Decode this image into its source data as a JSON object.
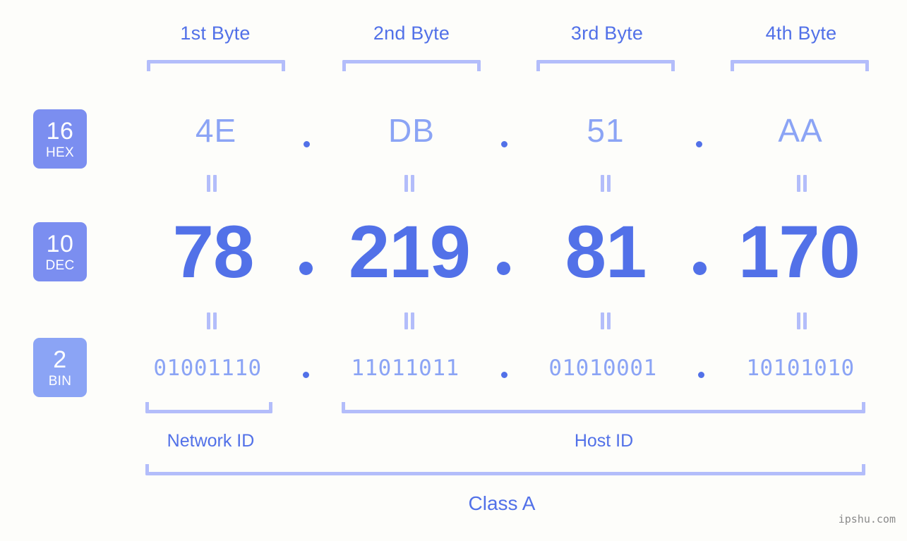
{
  "meta": {
    "watermark": "ipshu.com",
    "accent_strong": "#5271e8",
    "accent_light": "#8ba4f5",
    "accent_pale": "#b3bdfa",
    "badge_bg": "#7b8ef0",
    "badge_bg_light": "#8ba4f5",
    "background": "#fdfdfa"
  },
  "byte_headers": [
    {
      "label": "1st Byte"
    },
    {
      "label": "2nd Byte"
    },
    {
      "label": "3rd Byte"
    },
    {
      "label": "4th Byte"
    }
  ],
  "bases": [
    {
      "number": "16",
      "name": "HEX"
    },
    {
      "number": "10",
      "name": "DEC"
    },
    {
      "number": "2",
      "name": "BIN"
    }
  ],
  "separators": {
    "dot": ".",
    "equals": "="
  },
  "rows": {
    "hex": {
      "base_number": "16",
      "base_name": "HEX",
      "values": [
        "4E",
        "DB",
        "51",
        "AA"
      ]
    },
    "dec": {
      "base_number": "10",
      "base_name": "DEC",
      "values": [
        "78",
        "219",
        "81",
        "170"
      ]
    },
    "bin": {
      "base_number": "2",
      "base_name": "BIN",
      "values": [
        "01001110",
        "11011011",
        "01010001",
        "10101010"
      ]
    }
  },
  "sections": [
    {
      "label": "Network ID"
    },
    {
      "label": "Host ID"
    }
  ],
  "class": {
    "label": "Class A"
  },
  "address": {
    "dotted_decimal": "78.219.81.170",
    "dotted_hex": "4E.DB.51.AA",
    "dotted_binary": "01001110.11011011.01010001.10101010"
  }
}
